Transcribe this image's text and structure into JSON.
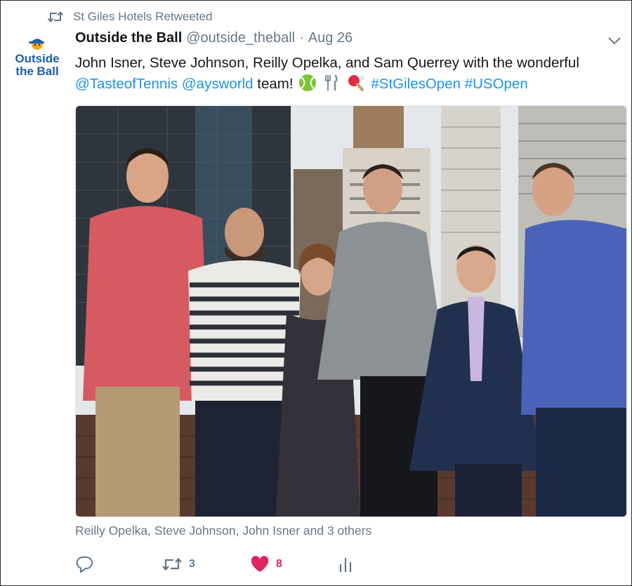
{
  "retweet_context": {
    "text": "St Giles Hotels Retweeted",
    "icon": "retweet-icon"
  },
  "avatar": {
    "logo_text_line1": "Outside",
    "logo_text_line2": "the Ball"
  },
  "tweet": {
    "author_name": "Outside the Ball",
    "author_handle": "@outside_theball",
    "separator": "·",
    "date": "Aug 26",
    "text_plain_1": "John Isner, Steve Johnson, Reilly Opelka, and Sam Querrey with the wonderful",
    "mention_1": "@TasteofTennis",
    "mention_2": "@aysworld",
    "text_plain_2": "team!",
    "emojis": [
      "tennis-ball-emoji",
      "fork-and-knife-emoji",
      "ping-pong-emoji"
    ],
    "hashtag_1": "#StGilesOpen",
    "hashtag_2": "#USOpen"
  },
  "tagged_people": "Reilly Opelka, Steve Johnson, John Isner and 3 others",
  "actions": {
    "replies": "",
    "retweets": "3",
    "likes": "8",
    "liked": true
  },
  "colors": {
    "link": "#1b95e0",
    "secondary_text": "#657786",
    "like": "#e0245e",
    "text": "#14171a"
  }
}
